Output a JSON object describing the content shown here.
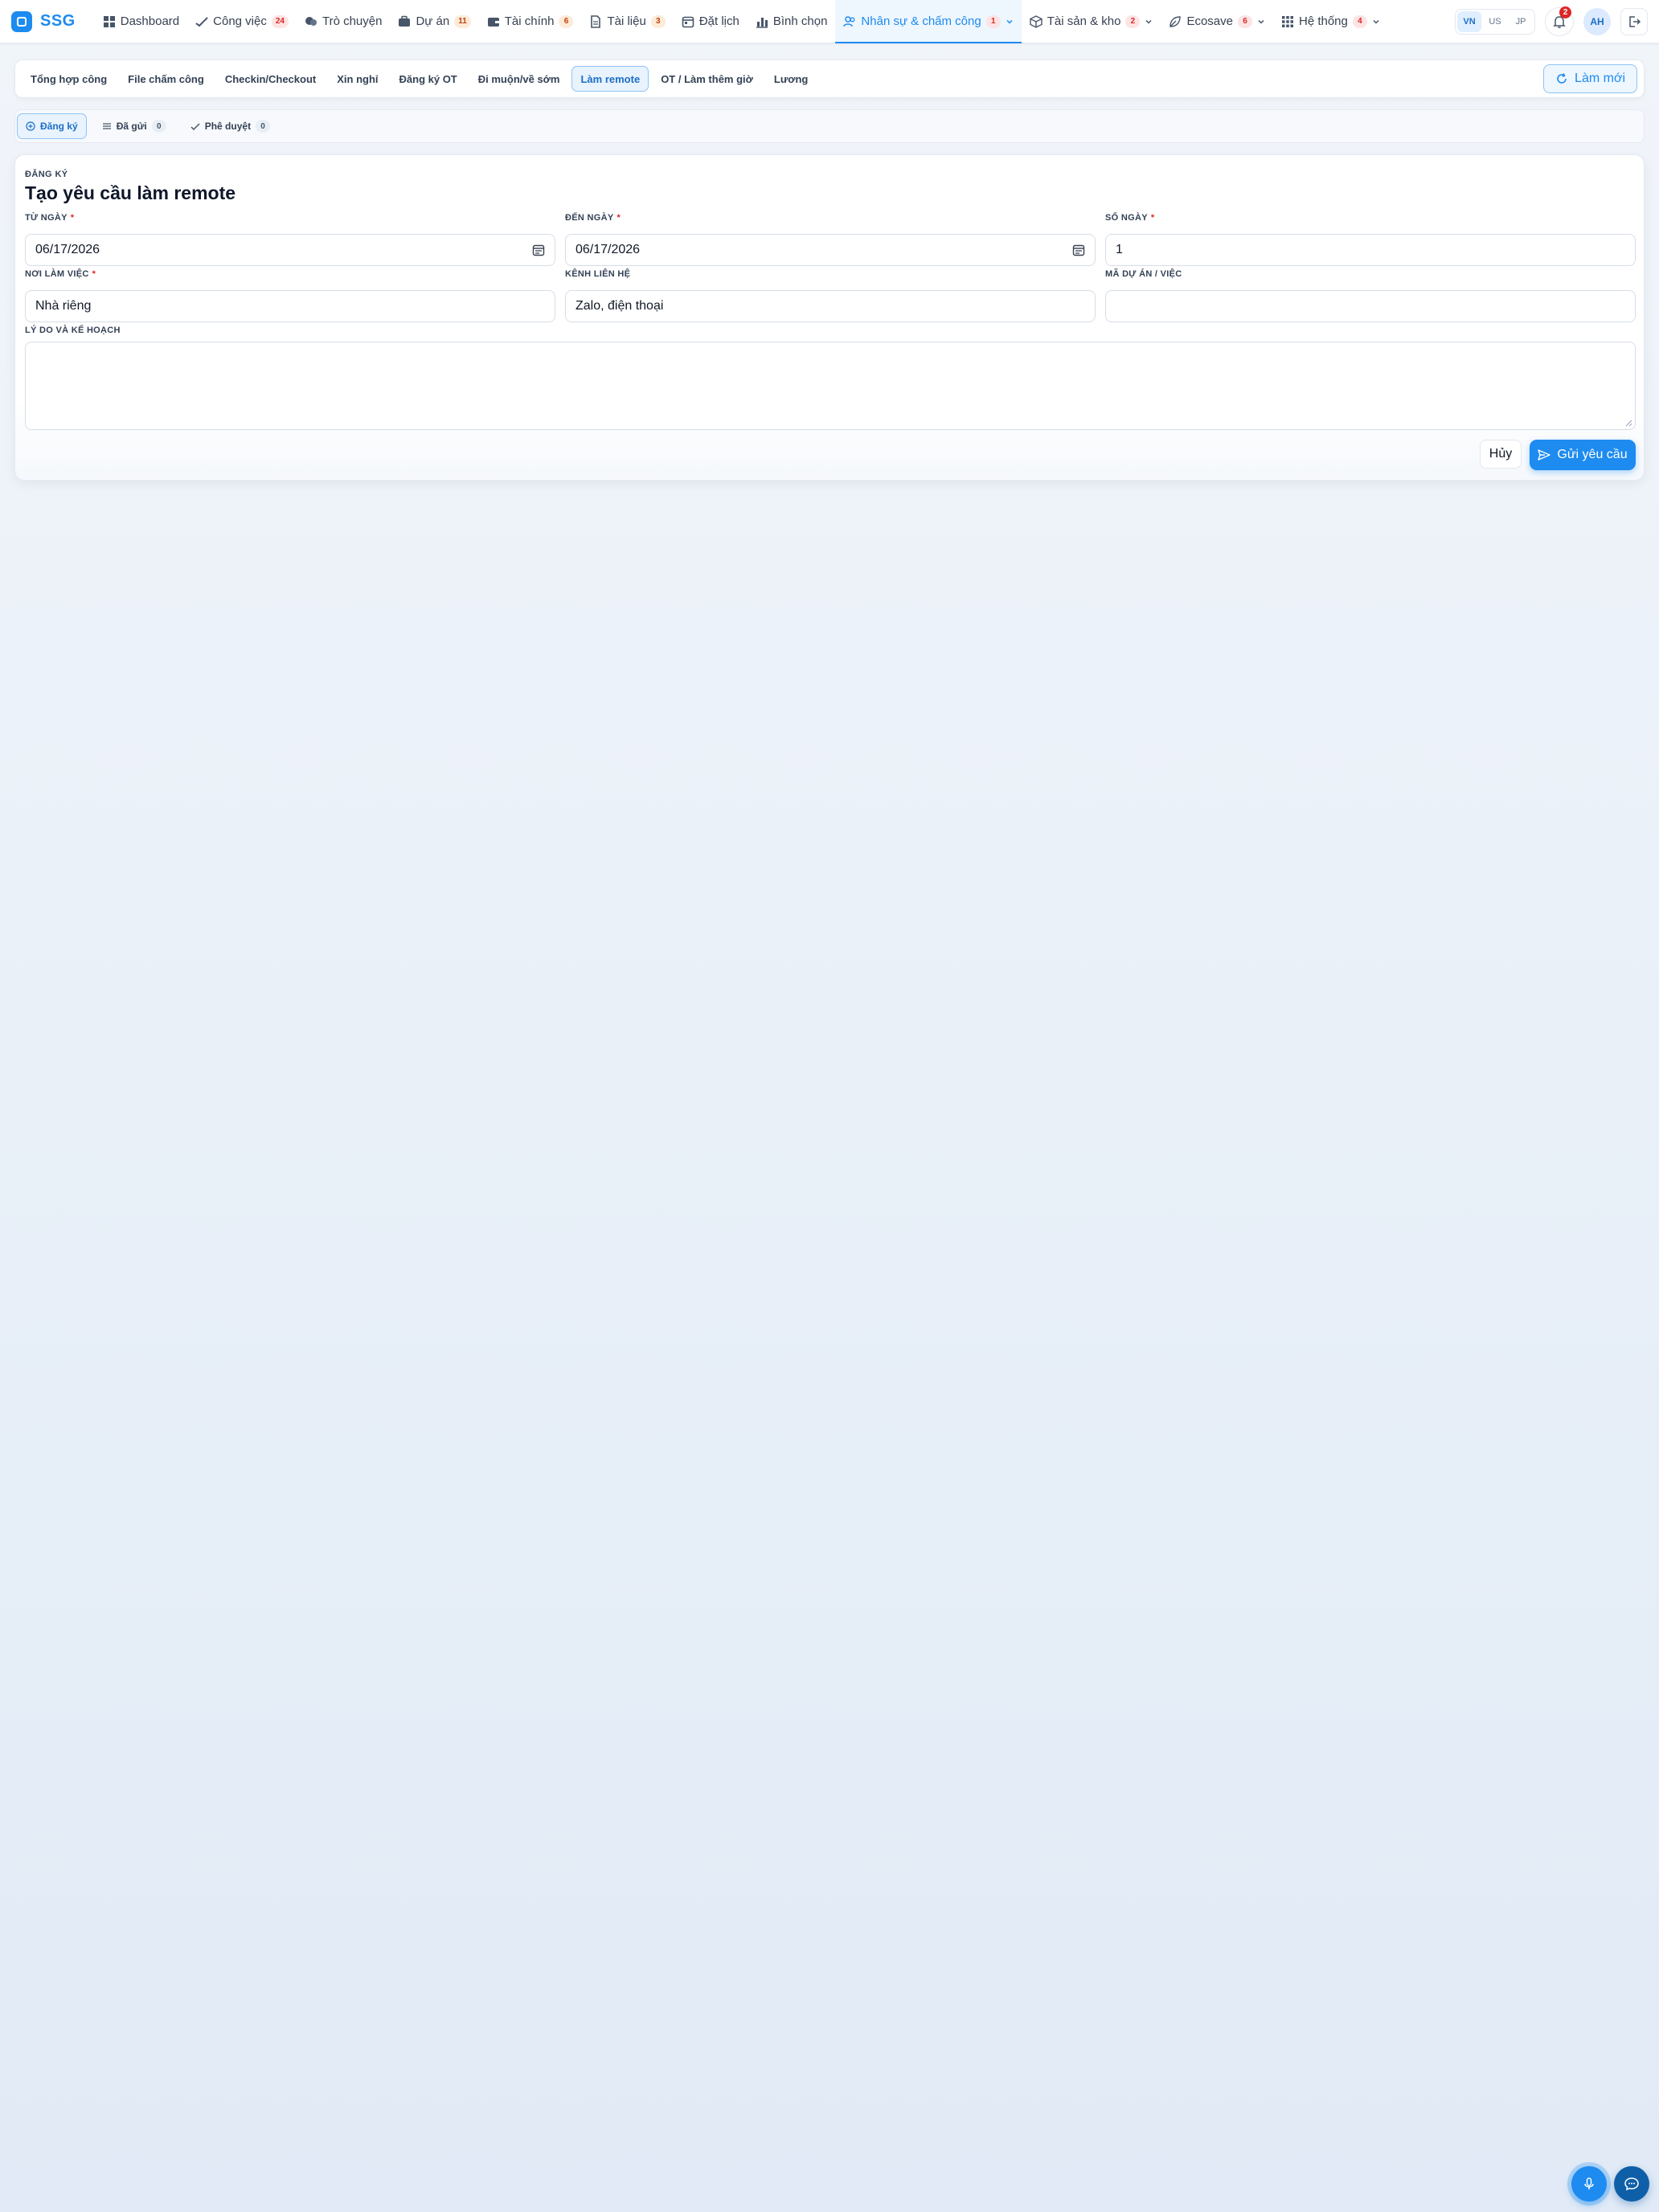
{
  "brand": {
    "name": "SSG"
  },
  "nav": {
    "items": [
      {
        "label": "Dashboard",
        "icon": "grid-icon"
      },
      {
        "label": "Công việc",
        "icon": "check-icon",
        "badge": "24"
      },
      {
        "label": "Trò chuyện",
        "icon": "chat-icon"
      },
      {
        "label": "Dự án",
        "icon": "briefcase-icon",
        "badge": "11"
      },
      {
        "label": "Tài chính",
        "icon": "wallet-icon",
        "badge": "6"
      },
      {
        "label": "Tài liệu",
        "icon": "file-icon",
        "badge": "3"
      },
      {
        "label": "Đặt lịch",
        "icon": "calendar-icon"
      },
      {
        "label": "Bình chọn",
        "icon": "bar-chart-icon"
      },
      {
        "label": "Nhân sự & chấm công",
        "icon": "users-icon",
        "badge": "1"
      },
      {
        "label": "Tài sản & kho",
        "icon": "box-icon",
        "badge": "2"
      },
      {
        "label": "Ecosave",
        "icon": "leaf-icon",
        "badge": "6"
      },
      {
        "label": "Hệ thống",
        "icon": "apps-icon",
        "badge": "4"
      }
    ],
    "languages": [
      "VN",
      "US",
      "JP"
    ],
    "notification_count": "2",
    "avatar": "AH"
  },
  "subnav": {
    "tabs": [
      "Tổng hợp công",
      "File chấm công",
      "Checkin/Checkout",
      "Xin nghỉ",
      "Đăng ký OT",
      "Đi muộn/về sớm",
      "Làm remote",
      "OT / Làm thêm giờ",
      "Lương"
    ],
    "refresh_label": "Làm mới"
  },
  "modes": {
    "register": "Đăng ký",
    "sent": "Đã gửi",
    "sent_count": "0",
    "approve": "Phê duyệt",
    "approve_count": "0"
  },
  "form": {
    "eyebrow": "ĐĂNG KÝ",
    "title": "Tạo yêu cầu làm remote",
    "from_date_label": "TỪ NGÀY",
    "from_date_value": "06/17/2026",
    "to_date_label": "ĐẾN NGÀY",
    "to_date_value": "06/17/2026",
    "days_label": "SỐ NGÀY",
    "days_value": "1",
    "place_label": "NƠI LÀM VIỆC",
    "place_value": "Nhà riêng",
    "contact_label": "KÊNH LIÊN HỆ",
    "contact_value": "Zalo, điện thoại",
    "project_label": "MÃ DỰ ÁN / VIỆC",
    "project_value": "",
    "reason_label": "LÝ DO VÀ KẾ HOẠCH",
    "reason_value": "",
    "required_mark": "*",
    "cancel_label": "Hủy",
    "submit_label": "Gửi yêu cầu"
  },
  "colors": {
    "accent": "#1d8bf0",
    "required": "#dc2626"
  }
}
